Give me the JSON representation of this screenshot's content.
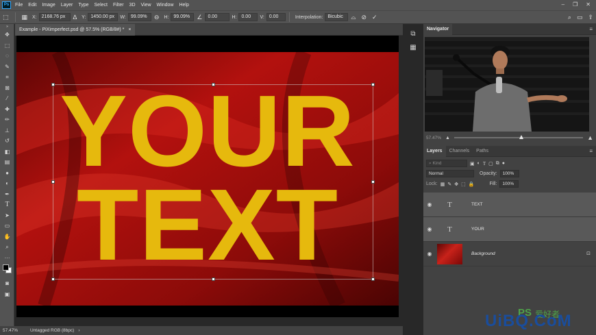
{
  "app": {
    "logo": "Ps",
    "menu": [
      "File",
      "Edit",
      "Image",
      "Layer",
      "Type",
      "Select",
      "Filter",
      "3D",
      "View",
      "Window",
      "Help"
    ]
  },
  "options": {
    "x_label": "X:",
    "x_value": "2168.76 px",
    "y_label": "Y:",
    "y_value": "1450.00 px",
    "w_label": "W:",
    "w_value": "99.09%",
    "h_label": "H:",
    "h_value": "99.09%",
    "rot_value": "0.00",
    "hskew_label": "H:",
    "hskew_value": "0.00",
    "vskew_label": "V:",
    "vskew_value": "0.00",
    "interp_label": "Interpolation:",
    "interp_value": "Bicubic"
  },
  "document": {
    "tab_title": "Example - PiXimperfect.psd @ 57.5% (RGB/8#) *",
    "tab_close": "×",
    "canvas_line1": "YOUR",
    "canvas_line2": "TEXT"
  },
  "status": {
    "zoom": "57.47%",
    "profile": "Untagged RGB (8bpc)"
  },
  "navigator": {
    "title": "Navigator",
    "zoom_value": "57.47%",
    "zoom_fraction": 0.52
  },
  "layers_panel": {
    "tabs": [
      "Layers",
      "Channels",
      "Paths"
    ],
    "filter_placeholder": "Kind",
    "blend_mode": "Normal",
    "opacity_label": "Opacity:",
    "opacity_value": "100%",
    "lock_label": "Lock:",
    "fill_label": "Fill:",
    "fill_value": "100%",
    "layers": [
      {
        "name": "TEXT",
        "thumb": "T",
        "selected": true
      },
      {
        "name": "YOUR",
        "thumb": "T",
        "selected": true
      },
      {
        "name": "Background",
        "thumb": "",
        "selected": false
      }
    ]
  },
  "watermark": {
    "text": "UiBQ.CoM",
    "ps": "PS",
    "sub": "爱好者"
  },
  "colors": {
    "text_yellow": "#e6b90d",
    "silk_red": "#b3110e",
    "ui_dark": "#424242"
  }
}
